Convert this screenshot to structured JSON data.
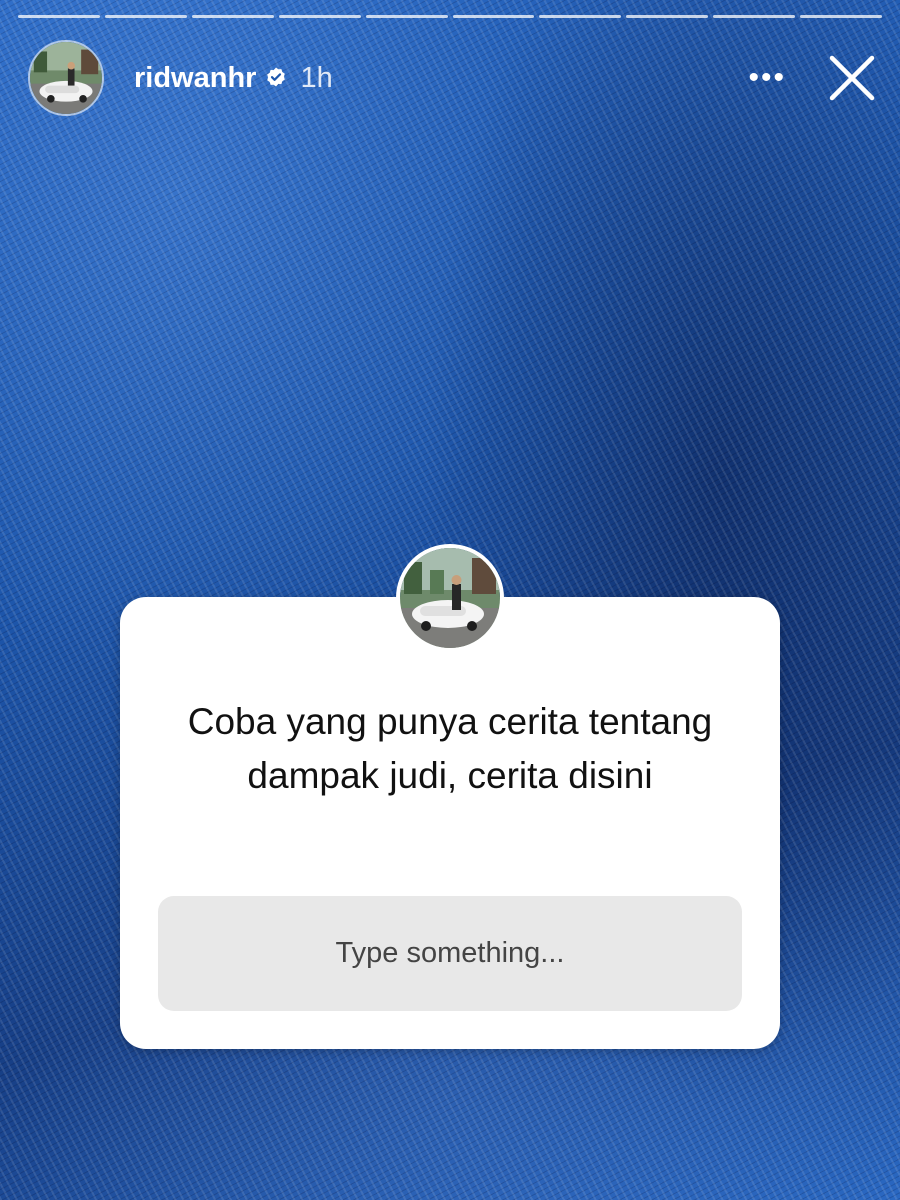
{
  "story": {
    "username": "ridwanhr",
    "posted_time": "1h",
    "more_label": "•••",
    "progress_segments": 10
  },
  "question_sticker": {
    "prompt": "Coba yang punya cerita tentang dampak judi, cerita disini",
    "answer_placeholder": "Type something..."
  },
  "icons": {
    "verified": "verified-badge-icon",
    "more": "more-options-icon",
    "close": "close-icon"
  },
  "colors": {
    "card_background": "#ffffff",
    "input_background": "#e8e8e8",
    "background": "#1b4f9a"
  }
}
